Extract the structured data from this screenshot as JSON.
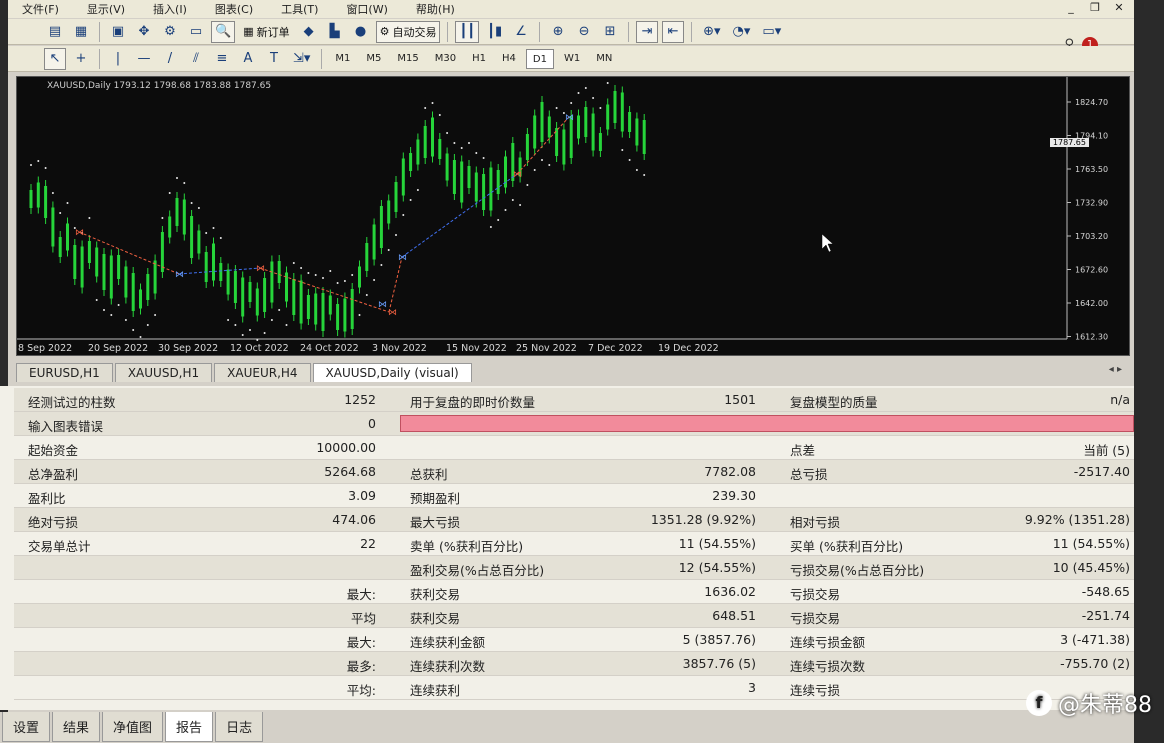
{
  "menu": [
    "文件(F)",
    "显示(V)",
    "插入(I)",
    "图表(C)",
    "工具(T)",
    "窗口(W)",
    "帮助(H)"
  ],
  "toolbar1": {
    "new_order": "新订单",
    "auto_trade": "自动交易"
  },
  "timeframes": [
    "M1",
    "M5",
    "M15",
    "M30",
    "H1",
    "H4",
    "D1",
    "W1",
    "MN"
  ],
  "active_timeframe": "D1",
  "alert_count": "1",
  "chart": {
    "info": "XAUUSD,Daily  1793.12 1798.68 1783.88 1787.65",
    "price_labels": [
      "1824.70",
      "1794.10",
      "1763.50",
      "1732.90",
      "1703.20",
      "1672.60",
      "1642.00",
      "1612.30"
    ],
    "current_price": "1787.65",
    "date_labels": [
      "8 Sep 2022",
      "20 Sep 2022",
      "30 Sep 2022",
      "12 Oct 2022",
      "24 Oct 2022",
      "3 Nov 2022",
      "15 Nov 2022",
      "25 Nov 2022",
      "7 Dec 2022",
      "19 Dec 2022"
    ]
  },
  "chart_tabs": [
    "EURUSD,H1",
    "XAUUSD,H1",
    "XAUEUR,H4",
    "XAUUSD,Daily (visual)"
  ],
  "report": {
    "r1": {
      "a": "经测试过的柱数",
      "b": "1252",
      "c": "用于复盘的即时价数量",
      "d": "1501",
      "e": "复盘模型的质量",
      "f": "n/a"
    },
    "r2": {
      "a": "输入图表错误",
      "b": "0"
    },
    "r3": {
      "a": "起始资金",
      "b": "10000.00",
      "e": "点差",
      "f": "当前 (5)"
    },
    "r4": {
      "a": "总净盈利",
      "b": "5264.68",
      "c": "总获利",
      "d": "7782.08",
      "e": "总亏损",
      "f": "-2517.40"
    },
    "r5": {
      "a": "盈利比",
      "b": "3.09",
      "c": "预期盈利",
      "d": "239.30"
    },
    "r6": {
      "a": "绝对亏损",
      "b": "474.06",
      "c": "最大亏损",
      "d": "1351.28 (9.92%)",
      "e": "相对亏损",
      "f": "9.92% (1351.28)"
    },
    "r7": {
      "a": "交易单总计",
      "b": "22",
      "c": "卖单 (%获利百分比)",
      "d": "11 (54.55%)",
      "e": "买单 (%获利百分比)",
      "f": "11 (54.55%)"
    },
    "r8": {
      "c": "盈利交易(%占总百分比)",
      "d": "12 (54.55%)",
      "e": "亏损交易(%占总百分比)",
      "f": "10 (45.45%)"
    },
    "r9": {
      "b": "最大:",
      "c": "获利交易",
      "d": "1636.02",
      "e": "亏损交易",
      "f": "-548.65"
    },
    "r10": {
      "b": "平均",
      "c": "获利交易",
      "d": "648.51",
      "e": "亏损交易",
      "f": "-251.74"
    },
    "r11": {
      "b": "最大:",
      "c": "连续获利金额",
      "d": "5 (3857.76)",
      "e": "连续亏损金额",
      "f": "3 (-471.38)"
    },
    "r12": {
      "b": "最多:",
      "c": "连续获利次数",
      "d": "3857.76 (5)",
      "e": "连续亏损次数",
      "f": "-755.70 (2)"
    },
    "r13": {
      "b": "平均:",
      "c": "连续获利",
      "d": "3",
      "e": "连续亏损"
    }
  },
  "bottom_tabs": [
    "设置",
    "结果",
    "净值图",
    "报告",
    "日志"
  ],
  "active_bottom_tab": "报告",
  "watermark": "@朱蒂88"
}
